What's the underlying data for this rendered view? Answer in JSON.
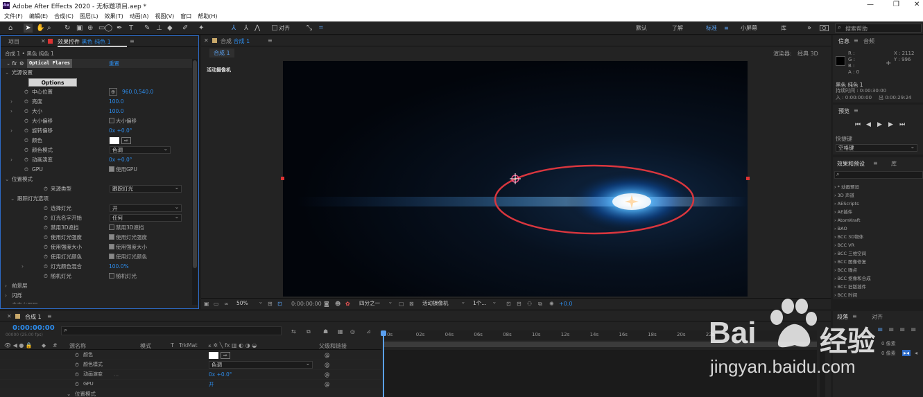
{
  "window": {
    "title": "Adobe After Effects 2020 - 无标题项目.aep *",
    "app_icon": "Ae",
    "controls": [
      "—",
      "❐",
      "✕"
    ]
  },
  "menu": [
    "文件(F)",
    "编辑(E)",
    "合成(C)",
    "图层(L)",
    "效果(T)",
    "动画(A)",
    "视图(V)",
    "窗口",
    "帮助(H)"
  ],
  "toolbar": {
    "snap_label": "对齐",
    "workspaces": [
      "默认",
      "了解",
      "标准",
      "小屏幕",
      "库"
    ],
    "search_placeholder": "搜索帮助",
    "more": "»"
  },
  "effects_panel": {
    "tab_project": "项目",
    "tab_effects_prefix": "效果控件",
    "tab_effects_layer": "黑色 纯色 1",
    "breadcrumb": "合成 1 • 黑色 纯色 1",
    "effect_name": "Optical Flares",
    "reset": "重置",
    "rows": [
      {
        "indent": 1,
        "tw": "⌄",
        "label": "光源设置"
      },
      {
        "indent": 2,
        "button": "Options"
      },
      {
        "indent": 2,
        "sw": true,
        "label": "中心位置",
        "value": "960.0,540.0",
        "blue": true,
        "crosshair": true
      },
      {
        "indent": 2,
        "tw": "›",
        "sw": true,
        "label": "亮度",
        "value": "100.0",
        "blue": true
      },
      {
        "indent": 2,
        "tw": "›",
        "sw": true,
        "label": "大小",
        "value": "100.0",
        "blue": true
      },
      {
        "indent": 2,
        "sw": true,
        "label": "大小偏移",
        "check": "大小偏移"
      },
      {
        "indent": 2,
        "tw": "›",
        "sw": true,
        "label": "旋转偏移",
        "value": "0x +0.0°",
        "blue": true
      },
      {
        "indent": 2,
        "sw": true,
        "label": "颜色",
        "swatch": true
      },
      {
        "indent": 2,
        "sw": true,
        "label": "颜色模式",
        "dropdown": "色调"
      },
      {
        "indent": 2,
        "tw": "›",
        "sw": true,
        "label": "动画演变",
        "value": "0x +0.0°",
        "blue": true
      },
      {
        "indent": 2,
        "sw": true,
        "label": "GPU",
        "check": "使用GPU",
        "on": true
      },
      {
        "indent": 1,
        "tw": "⌄",
        "label": "位置模式"
      },
      {
        "indent": 3,
        "sw": true,
        "label": "来源类型",
        "dropdown": "跟踪灯光"
      },
      {
        "indent": 2,
        "tw": "⌄",
        "label": "跟踪灯光选项"
      },
      {
        "indent": 4,
        "sw": true,
        "label": "选择灯光",
        "dropdown": "开"
      },
      {
        "indent": 4,
        "sw": true,
        "label": "灯光名字开始",
        "dropdown": "任何"
      },
      {
        "indent": 4,
        "sw": true,
        "label": "禁用3D遮挡",
        "check": "禁用3D遮挡"
      },
      {
        "indent": 4,
        "sw": true,
        "label": "使用灯光强度",
        "check": "使用灯光强度",
        "on": true
      },
      {
        "indent": 4,
        "sw": true,
        "label": "使用强度大小",
        "check": "使用强度大小",
        "on": true
      },
      {
        "indent": 4,
        "sw": true,
        "label": "使用灯光颜色",
        "check": "使用灯光颜色",
        "on": true
      },
      {
        "indent": 4,
        "tw": "›",
        "sw": true,
        "label": "灯光颜色混合",
        "value": "100.0%",
        "blue": true
      },
      {
        "indent": 4,
        "sw": true,
        "label": "随机灯光",
        "check": "随机灯光"
      },
      {
        "indent": 1,
        "tw": "›",
        "label": "前景层"
      },
      {
        "indent": 1,
        "tw": "›",
        "label": "闪烁"
      },
      {
        "indent": 1,
        "tw": "›",
        "label": "自定义图层"
      }
    ]
  },
  "comp_panel": {
    "tab_prefix": "合成",
    "tab_name": "合成 1",
    "subtab": "合成 1",
    "renderer_label": "渲染器:",
    "renderer": "经典 3D",
    "camera_label": "活动摄像机",
    "footer": {
      "zoom": "50%",
      "timecode": "0:00:00:00",
      "resolution": "四分之一",
      "camera": "活动摄像机",
      "views": "1个...",
      "exposure": "+0.0"
    }
  },
  "info_panel": {
    "tab_info": "信息",
    "tab_audio": "音频",
    "r": "R :",
    "g": "G :",
    "b": "B :",
    "a": "A : 0",
    "x": "X : 2112",
    "y": "Y : 996",
    "layer": "黑色 纯色 1",
    "duration": "持续时间 : 0:00:30:00",
    "in_point": "入 : 0:00:00:00",
    "out_point": "出 0:00:29:24"
  },
  "preview_panel": {
    "tab": "预览",
    "shortcut_label": "快捷键",
    "shortcut": "空格键"
  },
  "effects_presets": {
    "tab": "效果和预设",
    "tab_library": "库",
    "items": [
      "* 动画预设",
      "3D 声道",
      "AEScripts",
      "AE插件",
      "AtomKraft",
      "BAO",
      "BCC 3D物体",
      "BCC VR",
      "BCC 三维空间",
      "BCC 图像修复",
      "BCC 噪点",
      "BCC 抠像和合成",
      "BCC 旧版插件",
      "BCC 时间"
    ]
  },
  "align_panel": {
    "tab_para": "段落",
    "tab_align": "对齐",
    "px": "0 像素",
    "px2": "0 像素"
  },
  "timeline": {
    "tab": "合成 1",
    "timecode": "0:00:00:00",
    "timecode_sub": "00000 (25.00 fps)",
    "col_source": "源名称",
    "col_mode": "模式",
    "col_t": "T",
    "col_trkmat": "TrkMat",
    "col_parent": "父级和链接",
    "ticks": [
      "0s",
      "02s",
      "04s",
      "06s",
      "08s",
      "10s",
      "12s",
      "14s",
      "16s",
      "18s",
      "20s",
      "22s"
    ],
    "rows": [
      {
        "label": "颜色",
        "swatch": true
      },
      {
        "label": "颜色模式",
        "dropdown": "色调"
      },
      {
        "label": "动画演变",
        "dots": "...",
        "value": "0x +0.0°"
      },
      {
        "label": "GPU",
        "value": "开"
      },
      {
        "label": "位置模式",
        "group": true
      }
    ]
  },
  "watermark": {
    "brand": "Bai",
    "brand2": "经验",
    "url": "jingyan.baidu.com"
  },
  "colors": {
    "accent": "#2d8ceb",
    "ellipse": "#d9363e",
    "selection": "#4a77c4"
  }
}
